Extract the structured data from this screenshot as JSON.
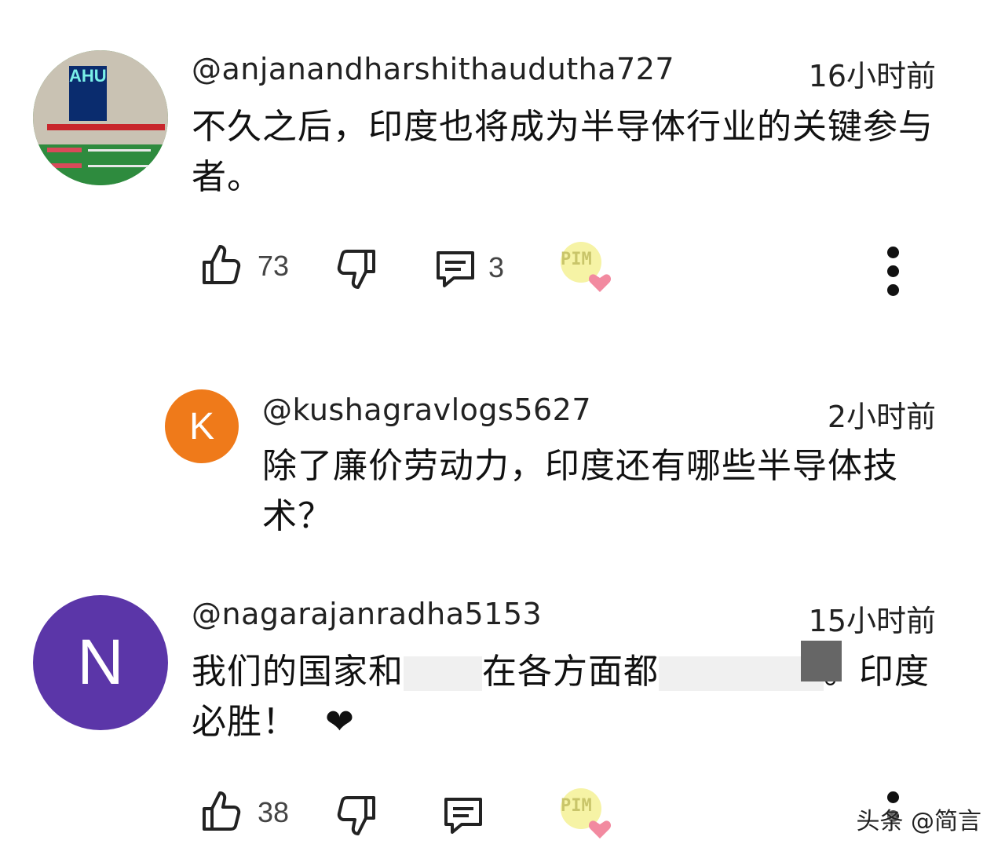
{
  "comments": [
    {
      "author": "@anjanandharshithaudutha727",
      "time": "16小时前",
      "text": "不久之后，印度也将成为半导体行业的关键参与者。",
      "likes": "73",
      "replies": "3",
      "avatar_label": "AHU",
      "avatar_color": "#2e8b3e"
    },
    {
      "author": "@kushagravlogs5627",
      "time": "2小时前",
      "text": "除了廉价劳动力，印度还有哪些半导体技术？",
      "avatar_letter": "K",
      "avatar_color": "#ef7a1a"
    },
    {
      "author": "@nagarajanradha5153",
      "time": "15小时前",
      "text_before": "我们的国家和",
      "text_after": "在各方面都",
      "text_end": "。印度必胜！",
      "heart_emoji": "❤",
      "likes": "38",
      "avatar_letter": "N",
      "avatar_color": "#5b36a8"
    }
  ],
  "creator_badge": "PIM",
  "watermark": "头条 @简言",
  "icons": [
    "thumbs-up-icon",
    "thumbs-down-icon",
    "reply-icon",
    "creator-heart-icon",
    "more-vert-icon"
  ]
}
